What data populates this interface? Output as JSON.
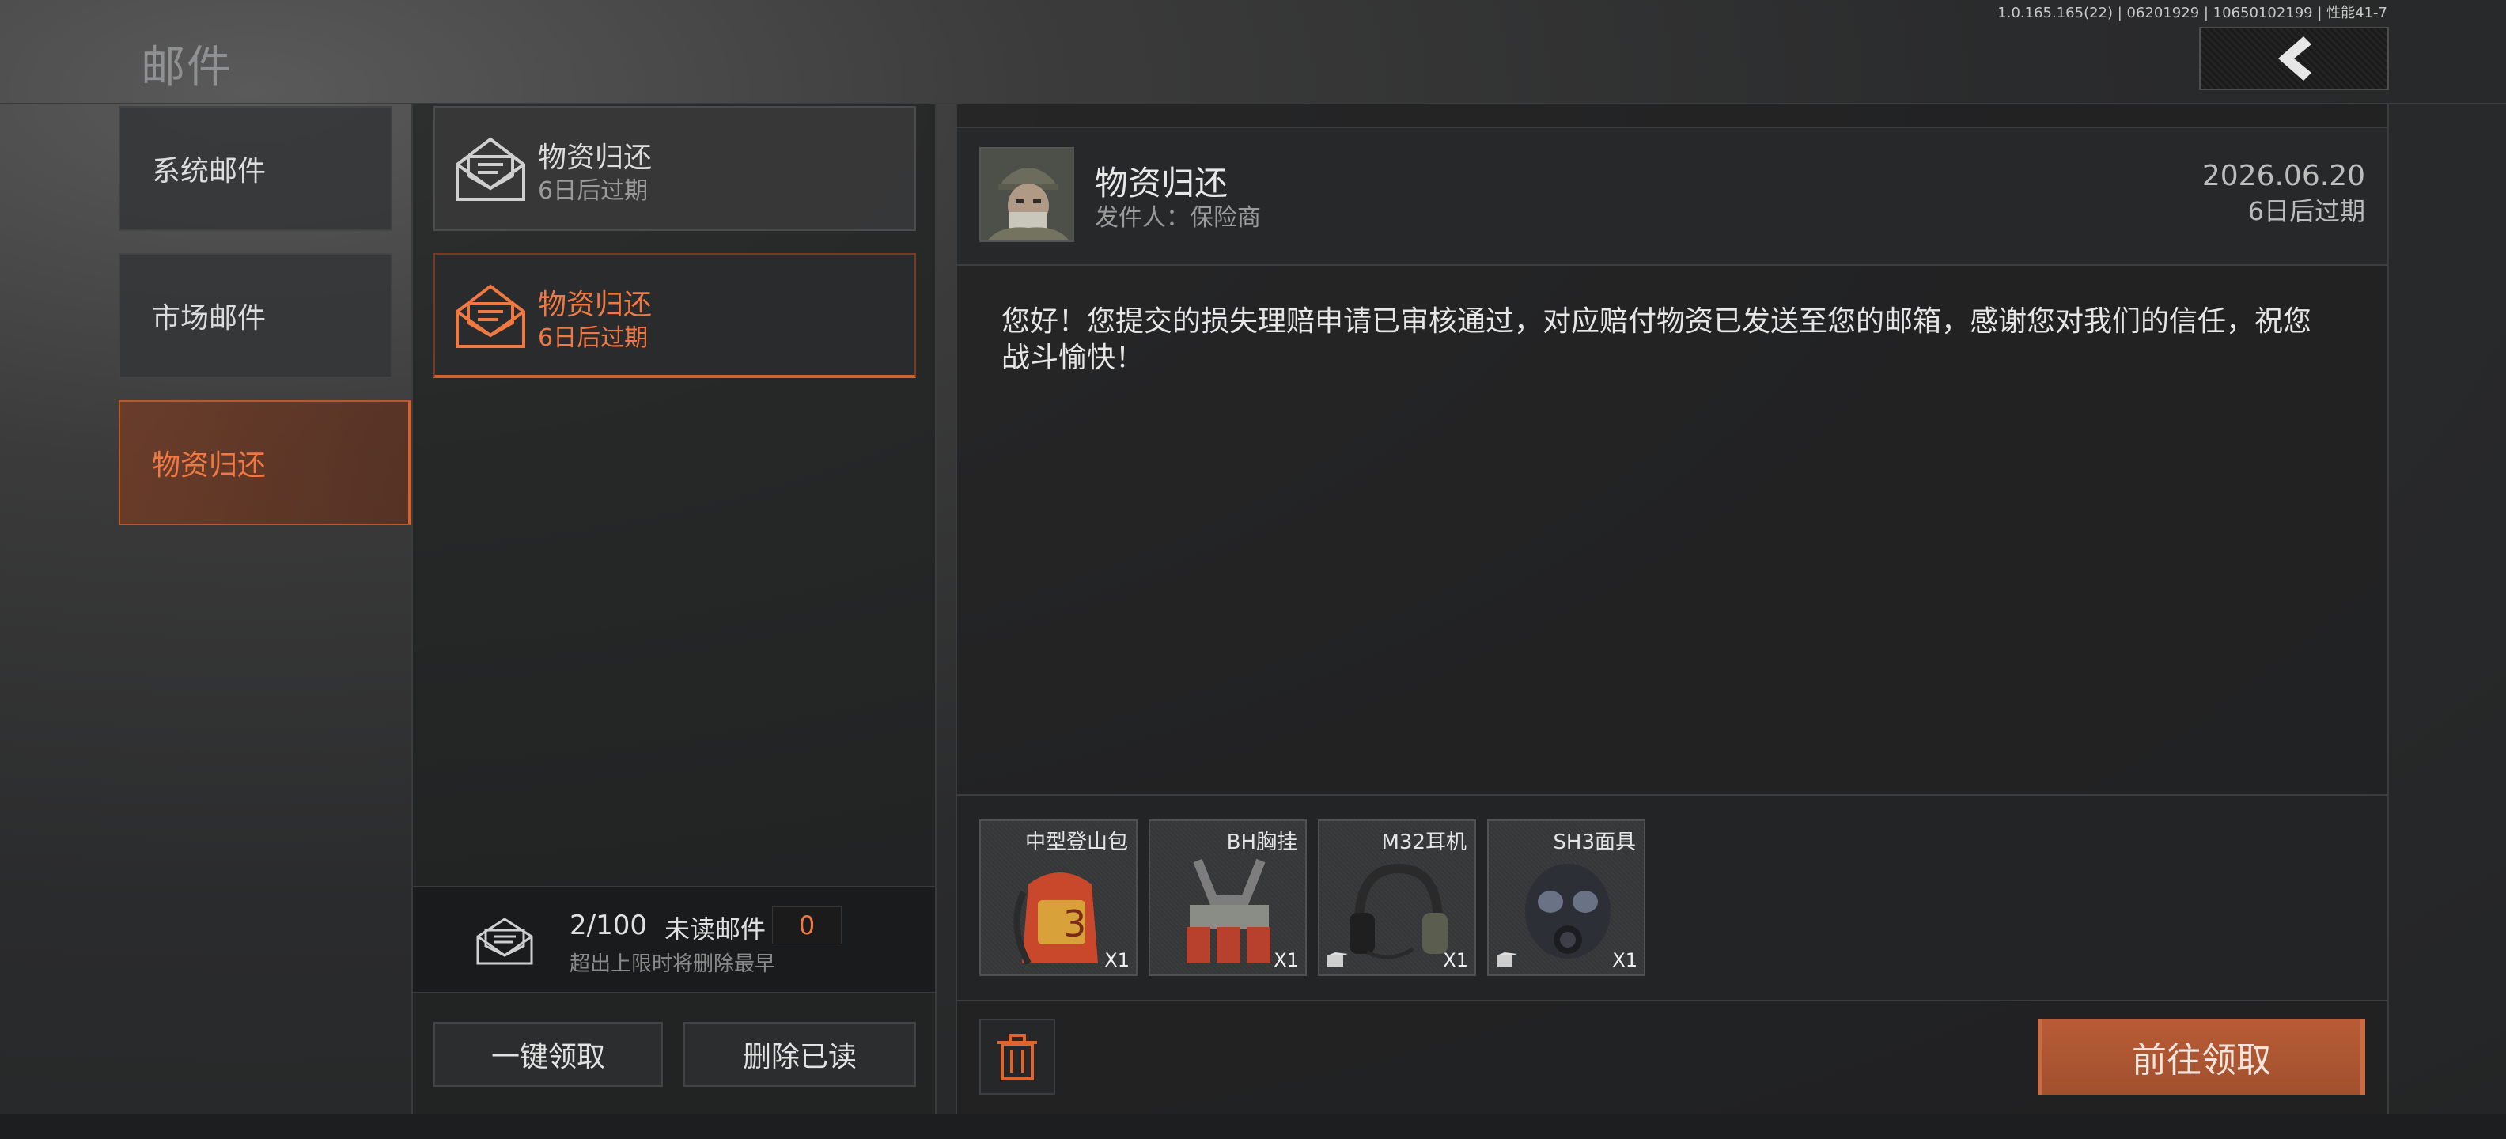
{
  "header": {
    "title": "邮件",
    "version": "1.0.165.165(22) | 06201929 | 10650102199 | 性能41-7",
    "back_icon": "chevron-left-icon"
  },
  "categories": [
    {
      "label": "系统邮件",
      "active": false
    },
    {
      "label": "市场邮件",
      "active": false
    },
    {
      "label": "物资归还",
      "active": true
    }
  ],
  "mail_list": [
    {
      "title": "物资归还",
      "expire": "6日后过期",
      "selected": false,
      "icon": "envelope-open-icon"
    },
    {
      "title": "物资归还",
      "expire": "6日后过期",
      "selected": true,
      "icon": "envelope-open-icon"
    }
  ],
  "counter": {
    "count": "2/100",
    "unread_label": "未读邮件",
    "unread_value": "0",
    "note": "超出上限时将删除最早"
  },
  "list_actions": {
    "claim_all": "一键领取",
    "delete_read": "删除已读"
  },
  "detail": {
    "title": "物资归还",
    "sender": "发件人：保险商",
    "date": "2026.06.20",
    "expire": "6日后过期",
    "body": "您好！您提交的损失理赔申请已审核通过，对应赔付物资已发送至您的邮箱，感谢您对我们的信任，祝您战斗愉快！",
    "attachments": [
      {
        "name": "中型登山包",
        "qty": "X1",
        "icon": "backpack-icon",
        "tagged": false
      },
      {
        "name": "BH胸挂",
        "qty": "X1",
        "icon": "chest-rig-icon",
        "tagged": false
      },
      {
        "name": "M32耳机",
        "qty": "X1",
        "icon": "headset-icon",
        "tagged": true
      },
      {
        "name": "SH3面具",
        "qty": "X1",
        "icon": "gas-mask-icon",
        "tagged": true
      }
    ],
    "trash_icon": "trash-icon",
    "goto_claim": "前往领取"
  },
  "colors": {
    "accent": "#d2632f",
    "accent_text": "#f07843",
    "button_primary": "#b85c36"
  }
}
